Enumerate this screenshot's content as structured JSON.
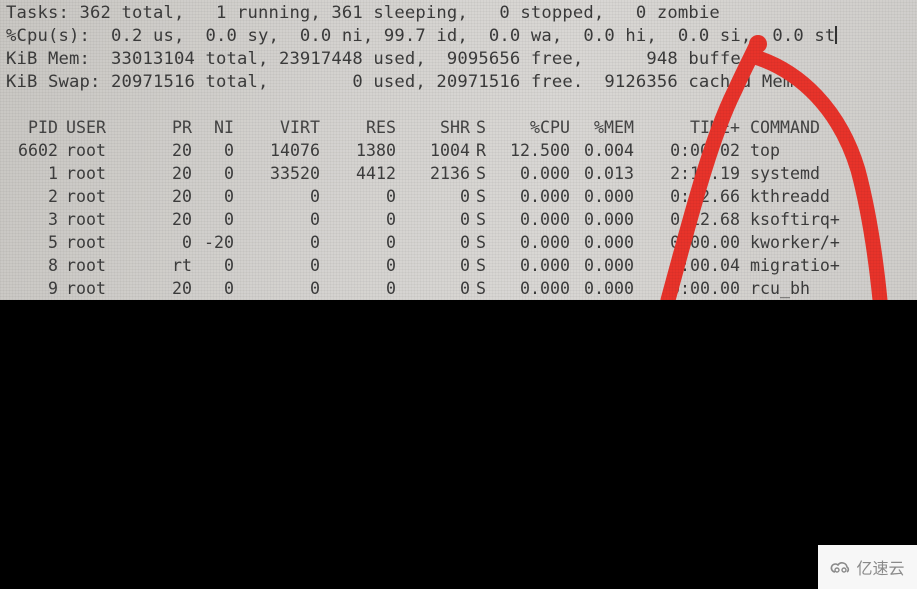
{
  "terminal": {
    "summary": {
      "tasks_line": "Tasks: 362 total,   1 running, 361 sleeping,   0 stopped,   0 zombie",
      "cpu_line": "%Cpu(s):  0.2 us,  0.0 sy,  0.0 ni, 99.7 id,  0.0 wa,  0.0 hi,  0.0 si,  0.0 st",
      "mem_line": "KiB Mem:  33013104 total, 23917448 used,  9095656 free,      948 buffers",
      "swap_line": "KiB Swap: 20971516 total,        0 used, 20971516 free.  9126356 cached Mem"
    },
    "columns": [
      "PID",
      "USER",
      "PR",
      "NI",
      "VIRT",
      "RES",
      "SHR",
      "S",
      "%CPU",
      "%MEM",
      "TIME+",
      "COMMAND"
    ],
    "processes": [
      {
        "pid": "6602",
        "user": "root",
        "pr": "20",
        "ni": "0",
        "virt": "14076",
        "res": "1380",
        "shr": "1004",
        "s": "R",
        "cpu": "12.500",
        "mem": "0.004",
        "time": "0:00.02",
        "command": "top"
      },
      {
        "pid": "1",
        "user": "root",
        "pr": "20",
        "ni": "0",
        "virt": "33520",
        "res": "4412",
        "shr": "2136",
        "s": "S",
        "cpu": "0.000",
        "mem": "0.013",
        "time": "2:15.19",
        "command": "systemd"
      },
      {
        "pid": "2",
        "user": "root",
        "pr": "20",
        "ni": "0",
        "virt": "0",
        "res": "0",
        "shr": "0",
        "s": "S",
        "cpu": "0.000",
        "mem": "0.000",
        "time": "0:02.66",
        "command": "kthreadd"
      },
      {
        "pid": "3",
        "user": "root",
        "pr": "20",
        "ni": "0",
        "virt": "0",
        "res": "0",
        "shr": "0",
        "s": "S",
        "cpu": "0.000",
        "mem": "0.000",
        "time": "0:12.68",
        "command": "ksoftirq+"
      },
      {
        "pid": "5",
        "user": "root",
        "pr": "0",
        "ni": "-20",
        "virt": "0",
        "res": "0",
        "shr": "0",
        "s": "S",
        "cpu": "0.000",
        "mem": "0.000",
        "time": "0:00.00",
        "command": "kworker/+"
      },
      {
        "pid": "8",
        "user": "root",
        "pr": "rt",
        "ni": "0",
        "virt": "0",
        "res": "0",
        "shr": "0",
        "s": "S",
        "cpu": "0.000",
        "mem": "0.000",
        "time": "0:00.04",
        "command": "migratio+"
      },
      {
        "pid": "9",
        "user": "root",
        "pr": "20",
        "ni": "0",
        "virt": "0",
        "res": "0",
        "shr": "0",
        "s": "S",
        "cpu": "0.000",
        "mem": "0.000",
        "time": "0:00.00",
        "command": "rcu_bh"
      }
    ]
  },
  "annotation": {
    "icon": "red-hand-drawn-arrow",
    "color": "#e8332a",
    "points_to": "0.0 si"
  },
  "watermark": {
    "icon": "cloud-logo-icon",
    "text": "亿速云"
  },
  "colors": {
    "screen_bg": "#d3d1ce",
    "text": "#3b3b3b",
    "frame": "#000000"
  }
}
